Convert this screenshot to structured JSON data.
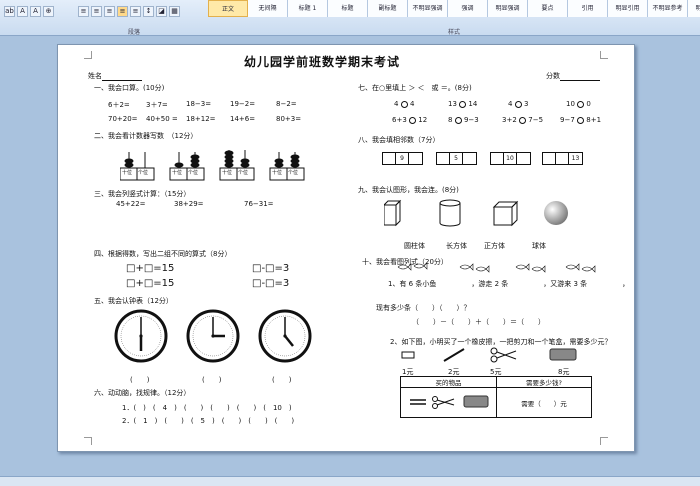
{
  "ribbon": {
    "group_paragraph": "段落",
    "group_styles": "样式",
    "styles": [
      "正文",
      "无间隔",
      "标题 1",
      "标题",
      "副标题",
      "不明显强调",
      "强调",
      "明显强调",
      "要点",
      "引用",
      "明显引用",
      "不明显参考",
      "明显参考"
    ]
  },
  "doc": {
    "title": "幼儿园学前班数学期末考试",
    "name_label": "姓名",
    "score_label": "分数",
    "s1": {
      "title": "一、我会口算。(10分)",
      "row1": [
        "6＋2=",
        "3＋7=",
        "18−3=",
        "19−2=",
        "8−2="
      ],
      "row2": [
        "70+20=",
        "40+50 =",
        "18+12=",
        "14+6=",
        "80+3="
      ]
    },
    "s2": {
      "title": "二、我会看计数器写数　（12分）",
      "labels": [
        "十位",
        "个位"
      ]
    },
    "s3": {
      "title": "三、我会列竖式计算：（15分）",
      "items": [
        "45+22=",
        "38+29=",
        "76−31="
      ]
    },
    "s4": {
      "title": "四、根据得数，写出二组不同的算式（8分）",
      "eq": [
        "□+□=15",
        "□-□=3",
        "□+□=15",
        "□-□=3"
      ]
    },
    "s5": {
      "title": "五、我会认钟表（12分）",
      "paren": "(　　)"
    },
    "s6": {
      "title": "六、动动脑，找规律。（12分）",
      "row1": "1．(　)　(　4　)　(　　)　(　　)　(　　)　(　10　)",
      "row2": "2．(　1　)　(　　)　(　5　)　(　　)　(　　)　(　　)"
    },
    "s7": {
      "title": "七、在○里填上 ＞ ＜　或 ＝。(8分)",
      "row1": [
        [
          "4",
          "4"
        ],
        [
          "13",
          "14"
        ],
        [
          "4",
          "3"
        ],
        [
          "10",
          "0"
        ]
      ],
      "row2": [
        [
          "6+3",
          "12"
        ],
        [
          "8",
          "9−3"
        ],
        [
          "3+2",
          "7−5"
        ],
        [
          "9−7",
          "8+1"
        ]
      ]
    },
    "s8": {
      "title": "八、我会填相邻数（7分）",
      "nums": [
        "9",
        "5",
        "10",
        "13"
      ]
    },
    "s9": {
      "title": "九、我会认图形，我会连。(8分)",
      "shapes": [
        "圆柱体",
        "长方体",
        "正方体",
        "球体"
      ]
    },
    "s10": {
      "title": "十、我会看图列式（20分）",
      "q1": "1、有 6 条小鱼　　　　　，游走 2 条　　　　　，又游来 3 条　　　　　，",
      "q1b": "现有多少条（　　）（　　）？",
      "q1c": "（　　）－（　　）＋（　　）＝（　　）",
      "q2": "2、如下图，小明买了一个橡皮擦，一把剪刀和一个笔盒，需要多少元？",
      "prices": [
        "1元",
        "2元",
        "5元",
        "8元"
      ],
      "th": [
        "买的物品",
        "需要多少钱?"
      ],
      "need": "需要（　　）元"
    }
  }
}
